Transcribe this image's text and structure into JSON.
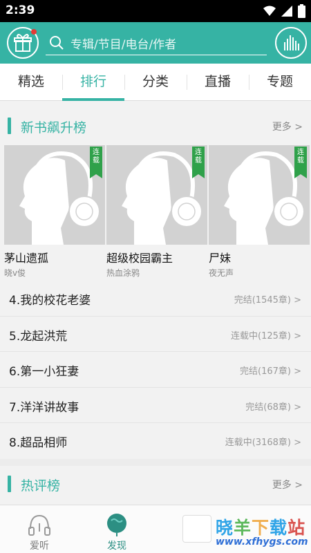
{
  "status_bar": {
    "time": "2:39"
  },
  "header": {
    "search_placeholder": "专辑/节目/电台/作者"
  },
  "tabs": [
    {
      "label": "精选",
      "active": false
    },
    {
      "label": "排行",
      "active": true
    },
    {
      "label": "分类",
      "active": false
    },
    {
      "label": "直播",
      "active": false
    },
    {
      "label": "专题",
      "active": false
    }
  ],
  "section_new": {
    "title": "新书飙升榜",
    "more": "更多 >"
  },
  "cards": [
    {
      "title": "茅山遗孤",
      "author": "晓v俊",
      "badge": "连载"
    },
    {
      "title": "超级校园霸主",
      "author": "热血涂鸦",
      "badge": "连载"
    },
    {
      "title": "尸妹",
      "author": "夜无声",
      "badge": "连载"
    }
  ],
  "rank_list": [
    {
      "title": "4.我的校花老婆",
      "status": "完结(1545章) >"
    },
    {
      "title": "5.龙起洪荒",
      "status": "连载中(125章) >"
    },
    {
      "title": "6.第一小狂妻",
      "status": "完结(167章) >"
    },
    {
      "title": "7.洋洋讲故事",
      "status": "完结(68章) >"
    },
    {
      "title": "8.超品相师",
      "status": "连载中(3168章) >"
    }
  ],
  "section_hot": {
    "title": "热评榜",
    "more": "更多 >"
  },
  "bottom_nav": [
    {
      "label": "爱听",
      "icon": "headphones-icon"
    },
    {
      "label": "发现",
      "icon": "globe-icon",
      "active": true
    }
  ],
  "watermark": {
    "title": "晓羊下载站",
    "url": "www.xfhygs.com"
  },
  "colors": {
    "accent": "#36b3a4",
    "badge": "#2fa14a",
    "notify_dot": "#e53935"
  }
}
